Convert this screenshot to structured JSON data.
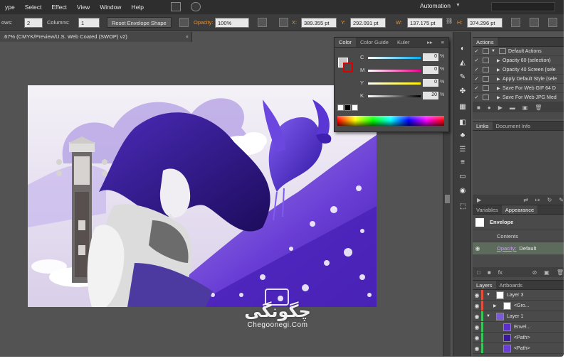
{
  "menu": {
    "items": [
      "ype",
      "Select",
      "Effect",
      "View",
      "Window",
      "Help"
    ],
    "workspace": "Automation"
  },
  "control_bar": {
    "rows_label": "ows:",
    "rows_value": "2",
    "columns_label": "Columns:",
    "columns_value": "1",
    "reset_button": "Reset Envelope Shape",
    "opacity_label": "Opacity:",
    "opacity_value": "100%",
    "x_label": "X:",
    "x_value": "389.355 pt",
    "y_label": "Y:",
    "y_value": "292.091 pt",
    "w_label": "W:",
    "w_value": "137.175 pt",
    "h_label": "H:",
    "h_value": "374.296 pt"
  },
  "document_tab": {
    "title": ".67% (CMYK/Preview/U.S. Web Coated (SWOP) v2)",
    "close": "×"
  },
  "color_panel": {
    "tabs": [
      "Color",
      "Color Guide",
      "Kuler"
    ],
    "sliders": [
      {
        "key": "C",
        "value": "0",
        "unit": "%"
      },
      {
        "key": "M",
        "value": "0",
        "unit": "%"
      },
      {
        "key": "Y",
        "value": "0",
        "unit": "%"
      },
      {
        "key": "K",
        "value": "20",
        "unit": "%"
      }
    ]
  },
  "actions_panel": {
    "tab": "Actions",
    "rows": [
      {
        "label": "Default Actions"
      },
      {
        "label": "Opacity 60 (selection)"
      },
      {
        "label": "Opacity 40 Screen (sele"
      },
      {
        "label": "Apply Default Style (sele"
      },
      {
        "label": "Save For Web GIF 64 D"
      },
      {
        "label": "Save For Web JPG Med"
      }
    ]
  },
  "links_panel": {
    "tabs": [
      "Links",
      "Document Info"
    ]
  },
  "appearance_panel": {
    "tabs": [
      "Variables",
      "Appearance"
    ],
    "object": "Envelope",
    "contents": "Contents",
    "opacity_link": "Opacity:",
    "opacity_value": "Default"
  },
  "layers_panel": {
    "tabs": [
      "Layers",
      "Artboards"
    ],
    "rows": [
      {
        "name": "Layer 3",
        "color": "#e2503c",
        "indent": 0,
        "expanded": true
      },
      {
        "name": "<Gro...",
        "color": "#e2503c",
        "indent": 1,
        "expanded": false
      },
      {
        "name": "Layer 1",
        "color": "#3bc45a",
        "indent": 0,
        "expanded": true
      },
      {
        "name": "Envel...",
        "color": "#3bc45a",
        "indent": 1,
        "expanded": false
      },
      {
        "name": "<Path>",
        "color": "#3bc45a",
        "indent": 1,
        "expanded": false
      },
      {
        "name": "<Path>",
        "color": "#3bc45a",
        "indent": 1,
        "expanded": false
      }
    ]
  },
  "watermark": {
    "text_fa": "چگونگی",
    "text_en": "Chegoonegi.Com"
  },
  "colors": {
    "accent_orange": "#e69232",
    "panel_bg": "#4a4a4a",
    "canvas_bg": "#535353",
    "art_purple": "#5b2fc9"
  }
}
